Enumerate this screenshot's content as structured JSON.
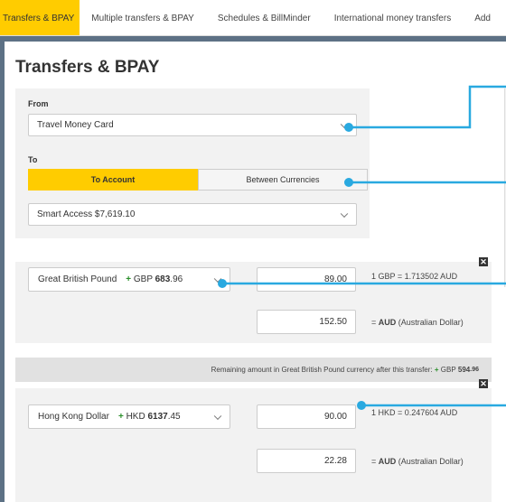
{
  "tabs": [
    {
      "label": "Transfers & BPAY",
      "active": true
    },
    {
      "label": "Multiple transfers & BPAY"
    },
    {
      "label": "Schedules & BillMinder"
    },
    {
      "label": "International money transfers"
    },
    {
      "label": "Add"
    }
  ],
  "page_title": "Transfers & BPAY",
  "from": {
    "label": "From",
    "value": "Travel Money Card"
  },
  "to": {
    "label": "To",
    "tab_account": "To Account",
    "tab_currencies": "Between Currencies",
    "value": "Smart Access $7,619.10"
  },
  "transfer1": {
    "currency": "Great British Pound",
    "balance_sign": "+",
    "balance_code": "GBP",
    "balance_whole": "683",
    "balance_frac": ".96",
    "amount": "89.00",
    "rate": "1 GBP = 1.713502 AUD",
    "aud_amount": "152.50",
    "aud_prefix": "= ",
    "aud_code": "AUD",
    "aud_name": " (Australian Dollar)",
    "close": "✕"
  },
  "remaining": {
    "text": "Remaining amount in Great British Pound currency after this transfer:",
    "sign": "+",
    "code": "GBP",
    "whole": "594",
    "frac": ".96"
  },
  "transfer2": {
    "currency": "Hong Kong Dollar",
    "balance_sign": "+",
    "balance_code": "HKD",
    "balance_whole": "6137",
    "balance_frac": ".45",
    "amount": "90.00",
    "rate": "1 HKD = 0.247604 AUD",
    "aud_amount": "22.28",
    "aud_prefix": "= ",
    "aud_code": "AUD",
    "aud_name": " (Australian Dollar)",
    "close": "✕"
  },
  "colors": {
    "accent": "#ffcc00",
    "callout": "#29a9e0",
    "positive": "#2a8f2a",
    "frame": "#5d7185"
  }
}
